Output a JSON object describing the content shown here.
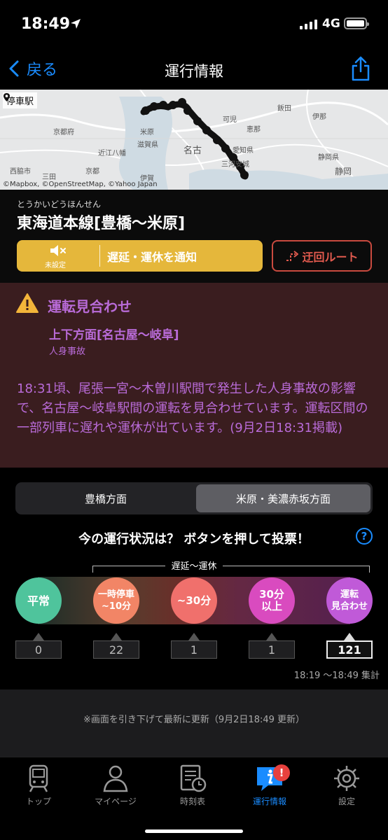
{
  "status": {
    "time": "18:49",
    "network": "4G"
  },
  "nav": {
    "back_label": "戻る",
    "title": "運行情報"
  },
  "map": {
    "legend": "停車駅",
    "attribution": "©Mapbox, ©OpenStreetMap, ©Yahoo Japan",
    "labels": [
      "京都府",
      "滋賀県",
      "近江八幡",
      "西脇市",
      "三田",
      "京都",
      "伊賀",
      "名古",
      "愛知県",
      "三河安城",
      "飯田",
      "伊那",
      "静岡県",
      "静岡",
      "恵那",
      "可児",
      "米原"
    ]
  },
  "line": {
    "furigana": "とうかいどうほんせん",
    "name": "東海道本線[豊橋〜米原]",
    "notify_unset": "未設定",
    "notify_label": "遅延・運休を通知",
    "detour_label": "迂回ルート"
  },
  "alert": {
    "title": "運転見合わせ",
    "section": "上下方面[名古屋〜岐阜]",
    "reason": "人身事故",
    "body": "18:31頃、尾張一宮〜木曽川駅間で発生した人身事故の影響で、名古屋〜岐阜駅間の運転を見合わせています。運転区間の一部列車に遅れや運休が出ています。(9月2日18:31掲載)"
  },
  "direction": {
    "tab_a": "豊橋方面",
    "tab_b": "米原・美濃赤坂方面",
    "selected": "tab_b"
  },
  "vote": {
    "question": "今の運行状況は？ ボタンを押して投票！",
    "help": "?",
    "bracket_label": "遅延〜運休",
    "options": [
      {
        "line1": "平常",
        "line2": "",
        "count": "0",
        "color": "#4fc49c"
      },
      {
        "line1": "一時停車",
        "line2": "~10分",
        "count": "22",
        "color": "#f28566"
      },
      {
        "line1": "~30分",
        "line2": "",
        "count": "1",
        "color": "#f0706c"
      },
      {
        "line1": "30分",
        "line2": "以上",
        "count": "1",
        "color": "#d94bbf"
      },
      {
        "line1": "運転",
        "line2": "見合わせ",
        "count": "121",
        "color": "#c05ad8"
      }
    ],
    "highlighted_option": 4,
    "period": "18:19 〜18:49 集計"
  },
  "refresh_note": "※画面を引き下げて最新に更新（9月2日18:49 更新）",
  "tabs": [
    {
      "label": "トップ",
      "icon": "train-icon"
    },
    {
      "label": "マイページ",
      "icon": "person-icon"
    },
    {
      "label": "時刻表",
      "icon": "timetable-icon"
    },
    {
      "label": "運行情報",
      "icon": "info-icon",
      "badge": "!"
    },
    {
      "label": "設定",
      "icon": "gear-icon"
    }
  ],
  "colors": {
    "accent": "#1a8cff",
    "notify": "#e5b73b",
    "detour": "#c94a3f",
    "alert_bg": "#3a1d1f",
    "alert_text": "#b96bd8"
  }
}
